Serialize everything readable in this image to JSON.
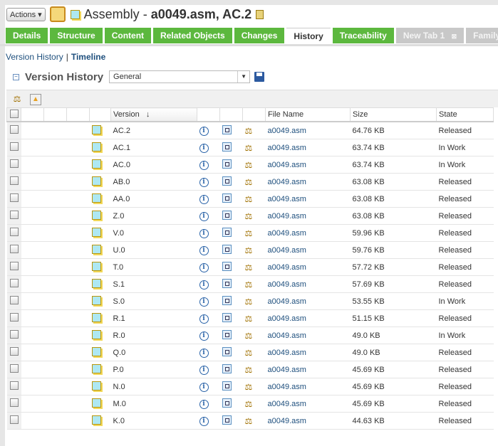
{
  "header": {
    "actions_label": "Actions",
    "type": "Assembly",
    "sep": " - ",
    "name": "a0049.asm, AC.2"
  },
  "tabs": [
    {
      "label": "Details"
    },
    {
      "label": "Structure"
    },
    {
      "label": "Content"
    },
    {
      "label": "Related Objects"
    },
    {
      "label": "Changes"
    },
    {
      "label": "History",
      "active": true
    },
    {
      "label": "Traceability"
    },
    {
      "label": "New Tab 1",
      "grey": true,
      "close": "⊠"
    },
    {
      "label": "Family",
      "grey": true
    }
  ],
  "subnav": {
    "version_history": "Version History",
    "sep": "|",
    "timeline": "Timeline"
  },
  "panel": {
    "title": "Version History",
    "view": "General"
  },
  "table": {
    "headers": {
      "version": "Version",
      "sort": "↓",
      "file": "File Name",
      "size": "Size",
      "state": "State"
    },
    "rows": [
      {
        "version": "AC.2",
        "file": "a0049.asm",
        "size": "64.76 KB",
        "state": "Released"
      },
      {
        "version": "AC.1",
        "file": "a0049.asm",
        "size": "63.74 KB",
        "state": "In Work"
      },
      {
        "version": "AC.0",
        "file": "a0049.asm",
        "size": "63.74 KB",
        "state": "In Work"
      },
      {
        "version": "AB.0",
        "file": "a0049.asm",
        "size": "63.08 KB",
        "state": "Released"
      },
      {
        "version": "AA.0",
        "file": "a0049.asm",
        "size": "63.08 KB",
        "state": "Released"
      },
      {
        "version": "Z.0",
        "file": "a0049.asm",
        "size": "63.08 KB",
        "state": "Released"
      },
      {
        "version": "V.0",
        "file": "a0049.asm",
        "size": "59.96 KB",
        "state": "Released"
      },
      {
        "version": "U.0",
        "file": "a0049.asm",
        "size": "59.76 KB",
        "state": "Released"
      },
      {
        "version": "T.0",
        "file": "a0049.asm",
        "size": "57.72 KB",
        "state": "Released"
      },
      {
        "version": "S.1",
        "file": "a0049.asm",
        "size": "57.69 KB",
        "state": "Released"
      },
      {
        "version": "S.0",
        "file": "a0049.asm",
        "size": "53.55 KB",
        "state": "In Work"
      },
      {
        "version": "R.1",
        "file": "a0049.asm",
        "size": "51.15 KB",
        "state": "Released"
      },
      {
        "version": "R.0",
        "file": "a0049.asm",
        "size": "49.0 KB",
        "state": "In Work"
      },
      {
        "version": "Q.0",
        "file": "a0049.asm",
        "size": "49.0 KB",
        "state": "Released"
      },
      {
        "version": "P.0",
        "file": "a0049.asm",
        "size": "45.69 KB",
        "state": "Released"
      },
      {
        "version": "N.0",
        "file": "a0049.asm",
        "size": "45.69 KB",
        "state": "Released"
      },
      {
        "version": "M.0",
        "file": "a0049.asm",
        "size": "45.69 KB",
        "state": "Released"
      },
      {
        "version": "K.0",
        "file": "a0049.asm",
        "size": "44.63 KB",
        "state": "Released"
      }
    ]
  }
}
